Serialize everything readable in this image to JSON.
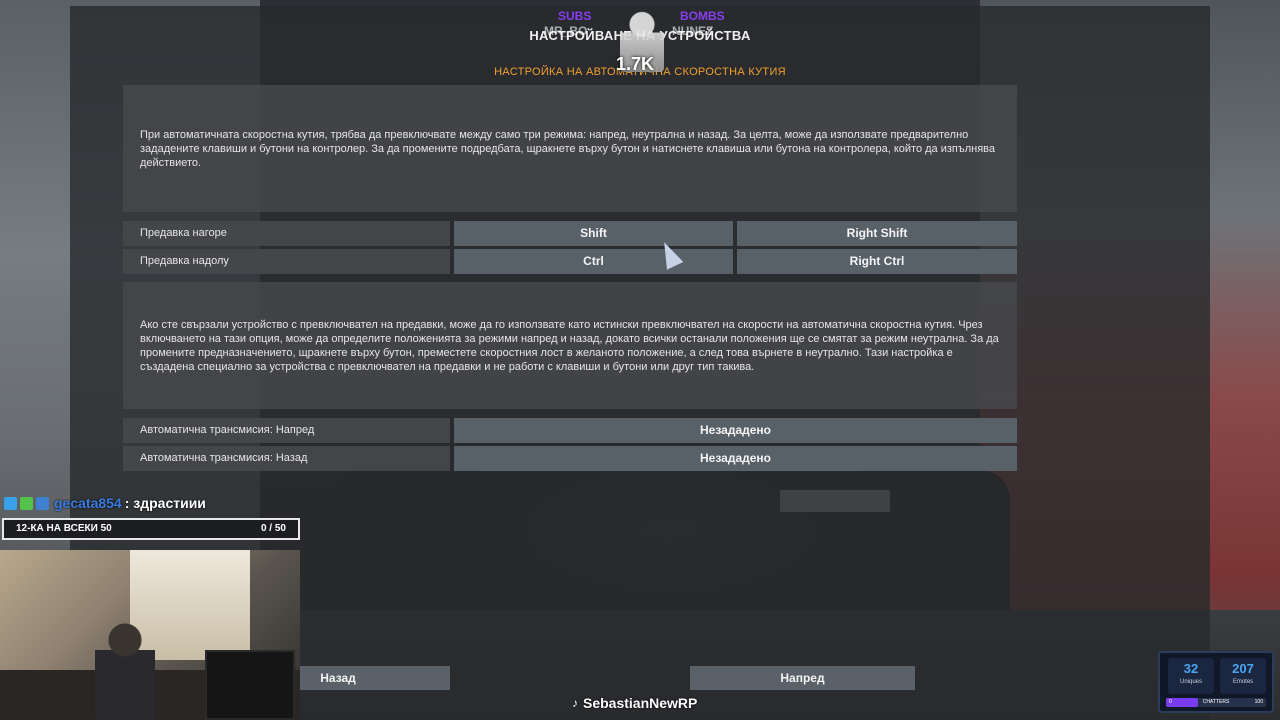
{
  "settings": {
    "title": "НАСТРОЙВАНЕ НА УСТРОЙСТВА",
    "subtitle": "НАСТРОЙКА НА АВТОМАТИЧНА СКОРОСТНА КУТИЯ",
    "description_1": "При автоматичната скоростна кутия, трябва да превключвате между само три режима: напред, неутрална и назад. За целта, може да използвате предварително зададените клавиши и бутони на контролер. За да промените подредбата, щракнете върху бутон и натиснете клавиша или бутона на контролера, който да изпълнява действието.",
    "shift_up": {
      "label": "Предавка нагоре",
      "primary": "Shift",
      "secondary": "Right Shift"
    },
    "shift_down": {
      "label": "Предавка надолу",
      "primary": "Ctrl",
      "secondary": "Right Ctrl"
    },
    "description_2": "Ако сте свързали устройство с превключвател на предавки, може да го използвате като истински превключвател на скорости на автоматична скоростна кутия. Чрез включването на тази опция, може да определите положенията за режими напред и назад, докато всички останали положения ще се смятат за режим неутрална. За да промените предназначението, щракнете върху бутон, преместете скоростния лост в желаното положение, а след това върнете в неутрално. Тази настройка е създадена специално за устройства с превключвател на предавки и не работи с клавиши и бутони или друг тип такива.",
    "auto_forward": {
      "label": "Автоматична трансмисия: Напред",
      "value": "Незададено"
    },
    "auto_reverse": {
      "label": "Автоматична трансмисия: Назад",
      "value": "Незададено"
    },
    "nav_back": "Назад",
    "nav_forward": "Напред"
  },
  "stream_alert": {
    "subs_label": "SUBS",
    "subs_user": "MR_BO",
    "bombs_label": "BOMBS",
    "bombs_user": "NUNEZ",
    "count": "1.7K"
  },
  "chat": {
    "username": "gecata854",
    "message": ": здрастиии"
  },
  "goal": {
    "label": "12-КА НА ВСЕКИ 50",
    "progress": "0 / 50"
  },
  "tiktok": {
    "handle": "SebastianNewRP"
  },
  "stats": {
    "uniques_value": "32",
    "uniques_label": "Uniques",
    "emotes_value": "207",
    "emotes_label": "Emotes",
    "bar_min": "0",
    "bar_label": "CHATTERS",
    "bar_max": "100",
    "bar_fill": 0.32
  },
  "colors": {
    "subtitle": "#f0a030",
    "button": "#586068",
    "alert_accent": "#8a3cf0",
    "chat_user": "#3a7be0",
    "stats_number": "#4aa4f0"
  }
}
